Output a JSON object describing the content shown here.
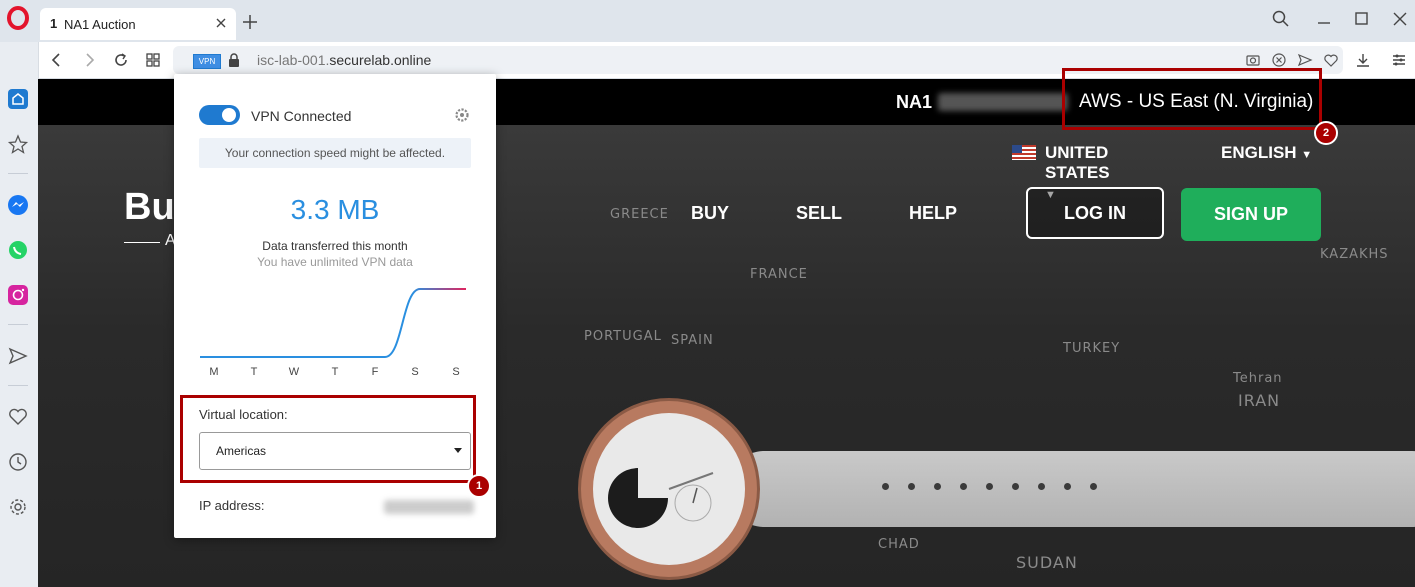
{
  "browser": {
    "tab": {
      "number": "1",
      "title": "NA1 Auction"
    },
    "url": {
      "prefix": "isc-lab-001.",
      "domain": "securelab.online"
    },
    "vpn_badge": "VPN"
  },
  "site": {
    "name": "NA1",
    "region": "AWS - US East (N. Virginia)",
    "country": "UNITED STATES",
    "language": "ENGLISH",
    "hero_title": "Buy",
    "hero_sub": "A",
    "nav": [
      "BUY",
      "SELL",
      "HELP"
    ],
    "login": "LOG IN",
    "signup": "SIGN UP",
    "map_labels": [
      "FRANCE",
      "SPAIN",
      "PORTUGAL",
      "TURKEY",
      "IRAN",
      "KAZAKHS",
      "CHAD",
      "SUDAN",
      "Tehran",
      "GREECE"
    ]
  },
  "vpn_popup": {
    "status": "VPN Connected",
    "note": "Your connection speed might be affected.",
    "data_amount": "3.3 MB",
    "data_label": "Data transferred this month",
    "unlimited": "You have unlimited VPN data",
    "days": [
      "M",
      "T",
      "W",
      "T",
      "F",
      "S",
      "S"
    ],
    "usage": [
      0,
      0,
      0,
      0,
      0,
      0,
      1
    ],
    "location_label": "Virtual location:",
    "location_value": "Americas",
    "ip_label": "IP address:"
  },
  "annotations": {
    "badge1": "1",
    "badge2": "2"
  },
  "colors": {
    "accent": "#1f7ad0",
    "signup": "#1fae5b",
    "annotation": "#a00"
  }
}
